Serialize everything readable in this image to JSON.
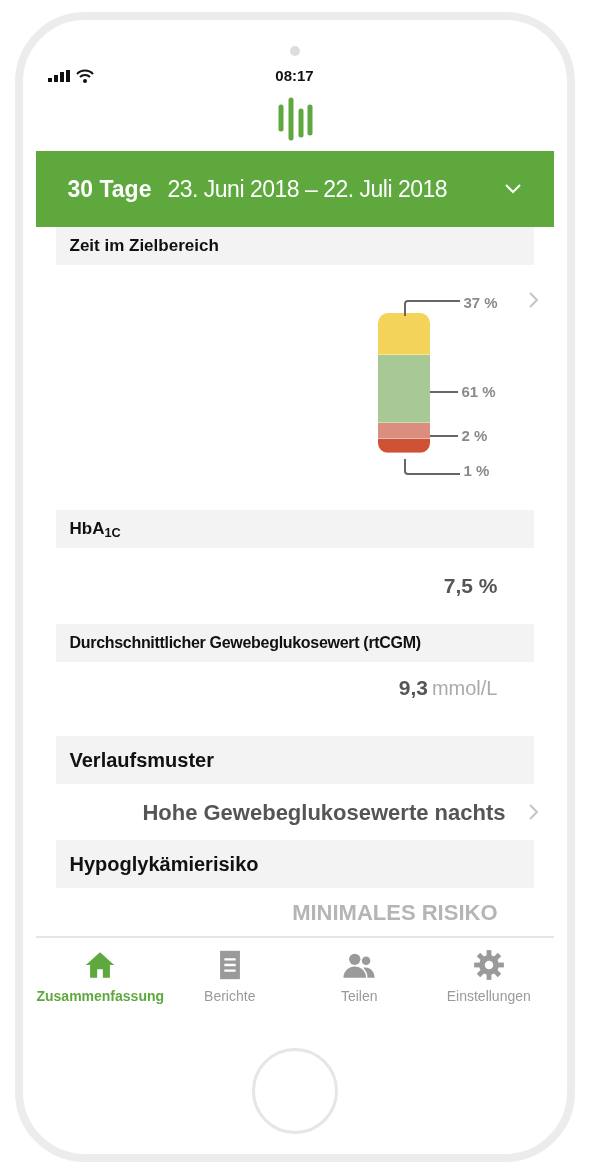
{
  "status_bar": {
    "time": "08:17"
  },
  "period": {
    "days": "30 Tage",
    "range": "23. Juni 2018 – 22. Juli 2018"
  },
  "time_in_range": {
    "title": "Zeit im Zielbereich",
    "segments": [
      {
        "label": "37 %",
        "color": "#f3d35a"
      },
      {
        "label": "61 %",
        "color": "#a6c996"
      },
      {
        "label": "2 %",
        "color": "#dc8e7e"
      },
      {
        "label": "1 %",
        "color": "#cf5234"
      }
    ]
  },
  "hba1c": {
    "title": "HbA$_{1C}$",
    "value": "7,5 %"
  },
  "average": {
    "title": "Durchschnittlicher Gewebeglukosewert (rtCGM)",
    "value": "9,3",
    "unit": "mmol/L"
  },
  "pattern": {
    "title": "Verlaufsmuster",
    "value": "Hohe Gewebeglukosewerte nachts"
  },
  "hypo": {
    "title": "Hypoglykämierisiko",
    "value": "MINIMALES RISIKO"
  },
  "nav": [
    {
      "kind": "home",
      "label": "Zusammenfassung",
      "selected": true
    },
    {
      "kind": "reports",
      "label": "Berichte",
      "selected": false
    },
    {
      "kind": "share",
      "label": "Teilen",
      "selected": false
    },
    {
      "kind": "settings",
      "label": "Einstellungen",
      "selected": false
    }
  ]
}
